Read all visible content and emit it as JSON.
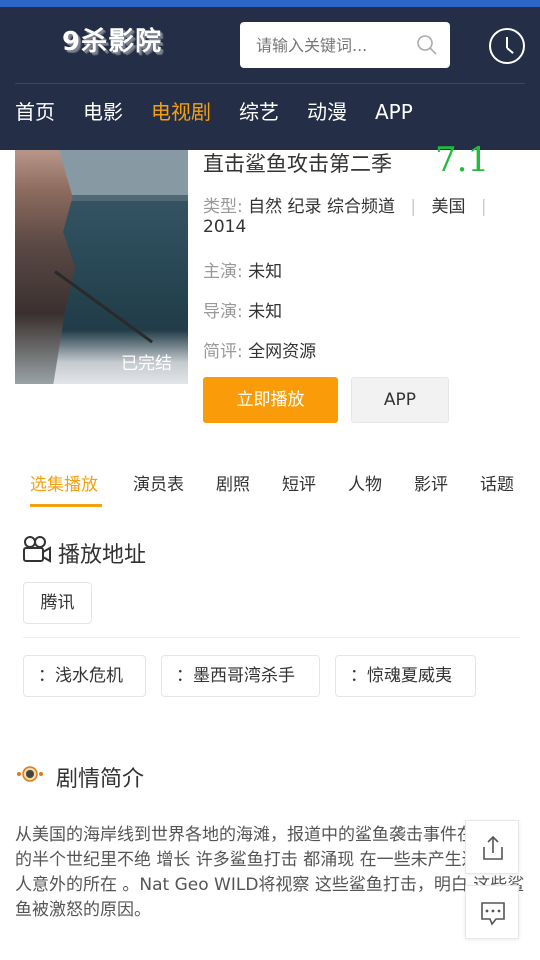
{
  "header": {
    "logo_text": "9杀影院",
    "search_placeholder": "请输入关键词...",
    "nav": [
      "首页",
      "电影",
      "电视剧",
      "综艺",
      "动漫",
      "APP"
    ],
    "active_nav_index": 2
  },
  "colors": {
    "header_bg": "#242f47",
    "top_strip": "#2c66c9",
    "accent": "#f5a011",
    "play_button": "#fa9c0a",
    "score_green": "#1ebd3c"
  },
  "poster": {
    "status": "已完结"
  },
  "detail": {
    "title": "直击鲨鱼攻击第二季",
    "score": "7.1",
    "type_label": "类型:",
    "type_value": "自然 纪录 综合频道",
    "region": "美国",
    "year": "2014",
    "actors_label": "主演:",
    "actors_value": "未知",
    "director_label": "导演:",
    "director_value": "未知",
    "review_label": "简评:",
    "review_value": "全网资源",
    "play_button": "立即播放",
    "app_button": "APP"
  },
  "tabs": [
    "选集播放",
    "演员表",
    "剧照",
    "短评",
    "人物",
    "影评",
    "话题"
  ],
  "active_tab_index": 0,
  "play_section": {
    "title": "播放地址",
    "icon": "video-camera-icon",
    "source": "腾讯",
    "episodes": [
      "：浅水危机",
      "：墨西哥湾杀手",
      "：惊魂夏威夷"
    ]
  },
  "synopsis": {
    "title": "剧情简介",
    "icon": "eye-icon",
    "text": "从美国的海岸线到世界各地的海滩，报道中的鲨鱼袭击事件在已往 的半个世纪里不绝 增长 许多鲨鱼打击 都涌现 在一些未产生过和令人意外的所在 。Nat Geo WILD将视察 这些鲨鱼打击，明白 这些鲨鱼被激怒的原因。"
  },
  "floating": {
    "share_icon": "share-icon",
    "comment_icon": "comment-icon"
  }
}
